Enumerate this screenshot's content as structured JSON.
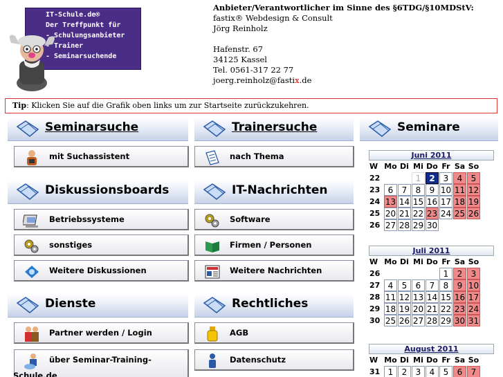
{
  "logo": {
    "lines": [
      "IT-Schule.de®",
      "Der Treffpunkt für",
      "- Schulungsanbieter",
      "- Trainer",
      "- Seminarsuchende"
    ]
  },
  "impressum": {
    "heading": "Anbieter/Verantwortlicher im Sinne des §6TDG/§10MDStV:",
    "company": "fastix® Webdesign & Consult",
    "name": "Jörg Reinholz",
    "street": "Hafenstr. 67",
    "city": "34125 Kassel",
    "tel": "Tel. 0561-317 22 77",
    "email_pre": "joerg.reinholz@fasti",
    "email_x": "x",
    "email_post": ".de"
  },
  "tip": {
    "label": "Tip",
    "text": ": Klicken Sie auf die Grafik oben links um zur Startseite zurückzukehren."
  },
  "sections": {
    "seminarsuche": "Seminarsuche",
    "trainersuche": "Trainersuche",
    "seminare": "Seminare",
    "diskussionsboards": "Diskussionsboards",
    "it_nachrichten": "IT-Nachrichten",
    "dienste": "Dienste",
    "rechtliches": "Rechtliches"
  },
  "buttons": {
    "suchassistent": "mit Suchassistent",
    "nach_thema": "nach Thema",
    "betriebssysteme": "Betriebssysteme",
    "software": "Software",
    "sonstiges": "sonstiges",
    "firmen_personen": "Firmen / Personen",
    "weitere_diskussionen": "Weitere Diskussionen",
    "weitere_nachrichten": "Weitere Nachrichten",
    "partner": "Partner werden / Login",
    "agb": "AGB",
    "ueber": "über Seminar-Training-",
    "ueber_2": "Schule.de",
    "datenschutz": "Datenschutz"
  },
  "calendar": {
    "weekdays": [
      "W",
      "Mo",
      "Di",
      "Mi",
      "Do",
      "Fr",
      "Sa",
      "So"
    ],
    "months": [
      {
        "title": "Juni 2011",
        "rows": [
          {
            "wk": "22",
            "days": [
              "",
              "",
              "1",
              "2",
              "3",
              "4",
              "5"
            ]
          },
          {
            "wk": "23",
            "days": [
              "6",
              "7",
              "8",
              "9",
              "10",
              "11",
              "12"
            ]
          },
          {
            "wk": "24",
            "days": [
              "13",
              "14",
              "15",
              "16",
              "17",
              "18",
              "19"
            ]
          },
          {
            "wk": "25",
            "days": [
              "20",
              "21",
              "22",
              "23",
              "24",
              "25",
              "26"
            ]
          },
          {
            "wk": "26",
            "days": [
              "27",
              "28",
              "29",
              "30",
              "",
              "",
              ""
            ]
          }
        ]
      },
      {
        "title": "Juli 2011",
        "rows": [
          {
            "wk": "26",
            "days": [
              "",
              "",
              "",
              "",
              "1",
              "2",
              "3"
            ]
          },
          {
            "wk": "27",
            "days": [
              "4",
              "5",
              "6",
              "7",
              "8",
              "9",
              "10"
            ]
          },
          {
            "wk": "28",
            "days": [
              "11",
              "12",
              "13",
              "14",
              "15",
              "16",
              "17"
            ]
          },
          {
            "wk": "29",
            "days": [
              "18",
              "19",
              "20",
              "21",
              "22",
              "23",
              "24"
            ]
          },
          {
            "wk": "30",
            "days": [
              "25",
              "26",
              "27",
              "28",
              "29",
              "30",
              "31"
            ]
          }
        ]
      },
      {
        "title": "August 2011",
        "rows": [
          {
            "wk": "31",
            "days": [
              "1",
              "2",
              "3",
              "4",
              "5",
              "6",
              "7"
            ]
          }
        ]
      }
    ]
  }
}
